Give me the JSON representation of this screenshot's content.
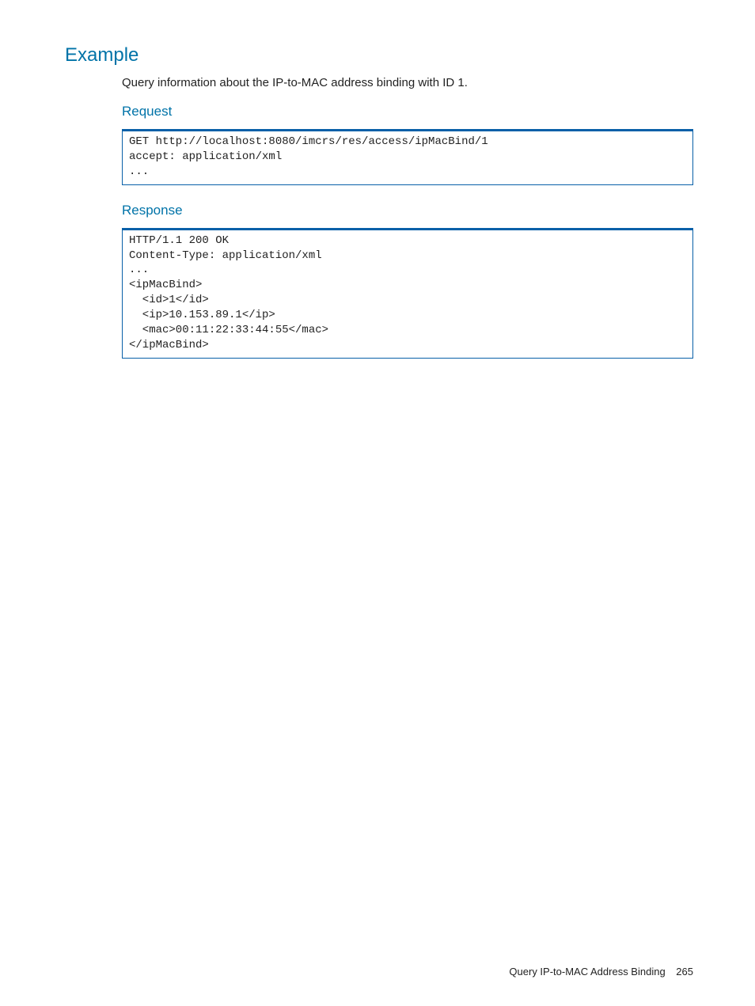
{
  "headings": {
    "example": "Example",
    "request": "Request",
    "response": "Response"
  },
  "intro": "Query information about the IP-to-MAC address binding with ID 1.",
  "code": {
    "request": "GET http://localhost:8080/imcrs/res/access/ipMacBind/1\naccept: application/xml\n...",
    "response": "HTTP/1.1 200 OK\nContent-Type: application/xml\n...\n<ipMacBind>\n  <id>1</id>\n  <ip>10.153.89.1</ip>\n  <mac>00:11:22:33:44:55</mac>\n</ipMacBind>"
  },
  "footer": {
    "title": "Query IP-to-MAC Address Binding",
    "page": "265"
  }
}
